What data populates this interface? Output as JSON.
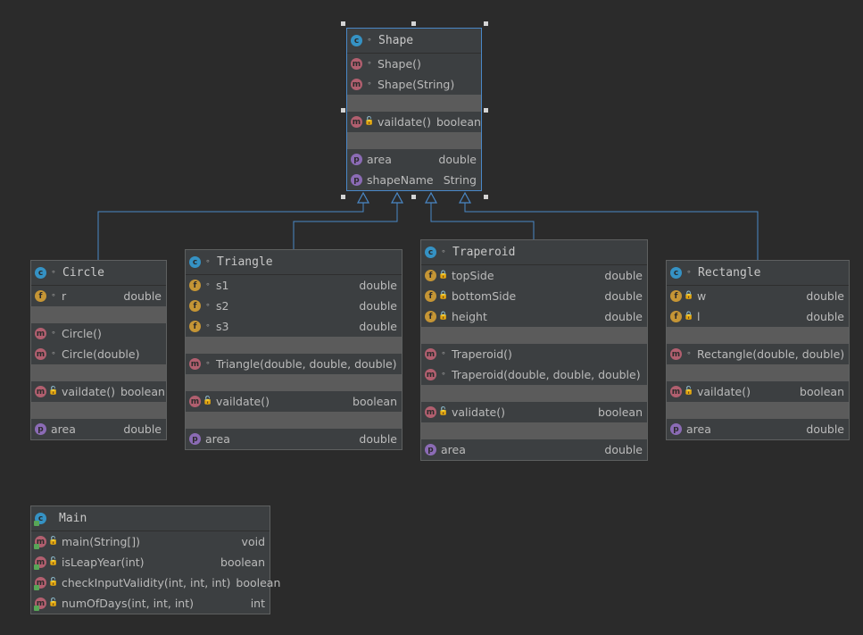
{
  "colors": {
    "background": "#2b2b2b",
    "class_fill": "#3c3f41",
    "selection": "#4a88c7",
    "edge": "#4a88c7"
  },
  "classes": {
    "shape": {
      "name": "Shape",
      "members": [
        {
          "kind": "m",
          "vis": "package",
          "label": "Shape()",
          "type": ""
        },
        {
          "kind": "m",
          "vis": "package",
          "label": "Shape(String)",
          "type": ""
        },
        {
          "kind": "m",
          "vis": "public",
          "label": "vaildate()",
          "type": "boolean"
        },
        {
          "kind": "p",
          "vis": "",
          "label": "area",
          "type": "double"
        },
        {
          "kind": "p",
          "vis": "",
          "label": "shapeName",
          "type": "String"
        }
      ]
    },
    "circle": {
      "name": "Circle",
      "members": [
        {
          "kind": "f",
          "vis": "package",
          "label": "r",
          "type": "double"
        },
        {
          "kind": "m",
          "vis": "package",
          "label": "Circle()",
          "type": ""
        },
        {
          "kind": "m",
          "vis": "package",
          "label": "Circle(double)",
          "type": ""
        },
        {
          "kind": "m",
          "vis": "public",
          "label": "vaildate()",
          "type": "boolean"
        },
        {
          "kind": "p",
          "vis": "",
          "label": "area",
          "type": "double"
        }
      ]
    },
    "triangle": {
      "name": "Triangle",
      "members": [
        {
          "kind": "f",
          "vis": "package",
          "label": "s1",
          "type": "double"
        },
        {
          "kind": "f",
          "vis": "package",
          "label": "s2",
          "type": "double"
        },
        {
          "kind": "f",
          "vis": "package",
          "label": "s3",
          "type": "double"
        },
        {
          "kind": "m",
          "vis": "package",
          "label": "Triangle(double, double, double)",
          "type": ""
        },
        {
          "kind": "m",
          "vis": "public",
          "label": "vaildate()",
          "type": "boolean"
        },
        {
          "kind": "p",
          "vis": "",
          "label": "area",
          "type": "double"
        }
      ]
    },
    "traperoid": {
      "name": "Traperoid",
      "members": [
        {
          "kind": "f",
          "vis": "private",
          "label": "topSide",
          "type": "double"
        },
        {
          "kind": "f",
          "vis": "private",
          "label": "bottomSide",
          "type": "double"
        },
        {
          "kind": "f",
          "vis": "private",
          "label": "height",
          "type": "double"
        },
        {
          "kind": "m",
          "vis": "package",
          "label": "Traperoid()",
          "type": ""
        },
        {
          "kind": "m",
          "vis": "package",
          "label": "Traperoid(double, double, double)",
          "type": ""
        },
        {
          "kind": "m",
          "vis": "public",
          "label": "validate()",
          "type": "boolean"
        },
        {
          "kind": "p",
          "vis": "",
          "label": "area",
          "type": "double"
        }
      ]
    },
    "rectangle": {
      "name": "Rectangle",
      "members": [
        {
          "kind": "f",
          "vis": "private",
          "label": "w",
          "type": "double"
        },
        {
          "kind": "f",
          "vis": "private",
          "label": "l",
          "type": "double"
        },
        {
          "kind": "m",
          "vis": "package",
          "label": "Rectangle(double, double)",
          "type": ""
        },
        {
          "kind": "m",
          "vis": "public",
          "label": "vaildate()",
          "type": "boolean"
        },
        {
          "kind": "p",
          "vis": "",
          "label": "area",
          "type": "double"
        }
      ]
    },
    "main": {
      "name": "Main",
      "members": [
        {
          "kind": "m",
          "vis": "public",
          "label": "main(String[])",
          "type": "void"
        },
        {
          "kind": "m",
          "vis": "public",
          "label": "isLeapYear(int)",
          "type": "boolean"
        },
        {
          "kind": "m",
          "vis": "public",
          "label": "checkInputValidity(int, int, int)",
          "type": "boolean"
        },
        {
          "kind": "m",
          "vis": "public",
          "label": "numOfDays(int, int, int)",
          "type": "int"
        }
      ]
    }
  },
  "badge_letters": {
    "class": "c",
    "method": "m",
    "field": "f",
    "property": "p"
  },
  "visibility_glyphs": {
    "package": "∘",
    "public": "🔓",
    "private": "🔒"
  }
}
